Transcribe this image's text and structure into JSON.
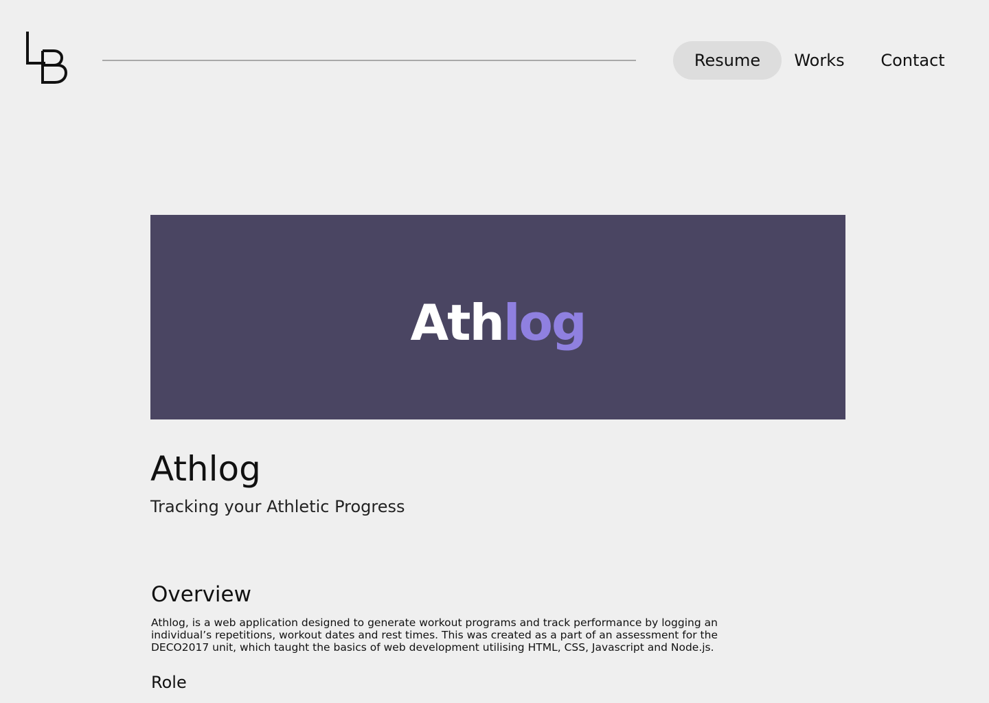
{
  "header": {
    "logo_text": "LB",
    "nav": {
      "resume_label": "Resume",
      "works_label": "Works",
      "contact_label": "Contact"
    }
  },
  "hero": {
    "wordmark_part1": "Ath",
    "wordmark_part2": "log",
    "background_color": "#4a4562",
    "accent_color": "#8f80e0"
  },
  "project": {
    "title": "Athlog",
    "tagline": "Tracking your Athletic Progress"
  },
  "overview": {
    "heading": "Overview",
    "body": "Athlog, is a web application designed to generate workout programs and track performance by logging an individual’s repetitions, workout dates and rest times. This was created as a part of an assessment for the DECO2017 unit, which taught the basics of web development utilising HTML, CSS, Javascript and Node.js."
  },
  "role": {
    "heading": "Role"
  }
}
